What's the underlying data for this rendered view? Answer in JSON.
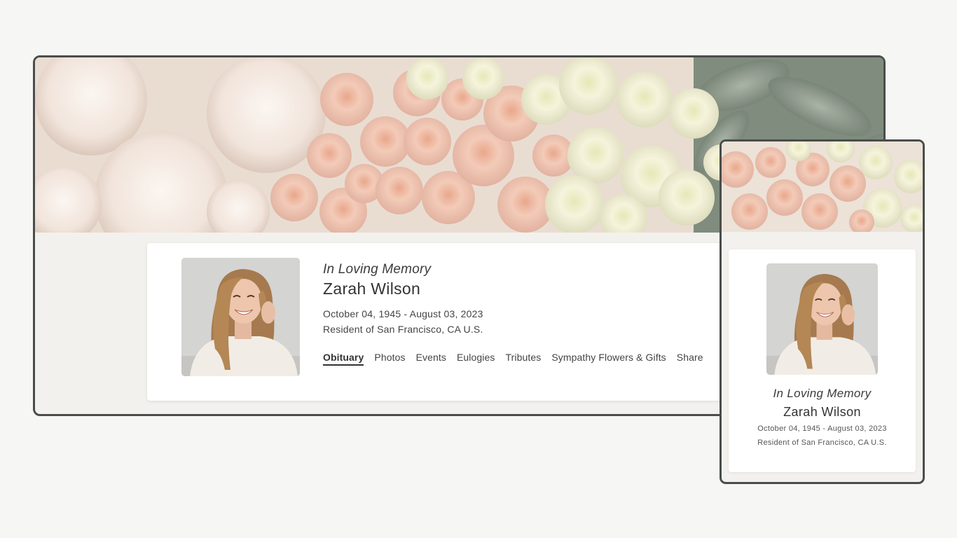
{
  "colors": {
    "frame_border": "#4a4d4a",
    "page_background": "#f6f6f5",
    "card_background": "#ffffff",
    "inner_background": "#f3f1ed",
    "peony": "#f4ece6",
    "rose_peach": "#efc6b1",
    "rose_cream": "#f2f1d6",
    "foliage": "#8d9a8c"
  },
  "memorial": {
    "tagline": "In Loving Memory",
    "name": "Zarah Wilson",
    "dates": "October 04, 1945 - August 03, 2023",
    "residence": "Resident of San Francisco, CA U.S."
  },
  "tabs": [
    {
      "label": "Obituary",
      "active": true
    },
    {
      "label": "Photos",
      "active": false
    },
    {
      "label": "Events",
      "active": false
    },
    {
      "label": "Eulogies",
      "active": false
    },
    {
      "label": "Tributes",
      "active": false
    },
    {
      "label": "Sympathy Flowers & Gifts",
      "active": false
    },
    {
      "label": "Share",
      "active": false
    }
  ],
  "mobile": {
    "tagline": "In Loving Memory",
    "name": "Zarah Wilson",
    "dates": "October 04, 1945 - August 03, 2023",
    "residence": "Resident of San Francisco, CA U.S."
  }
}
